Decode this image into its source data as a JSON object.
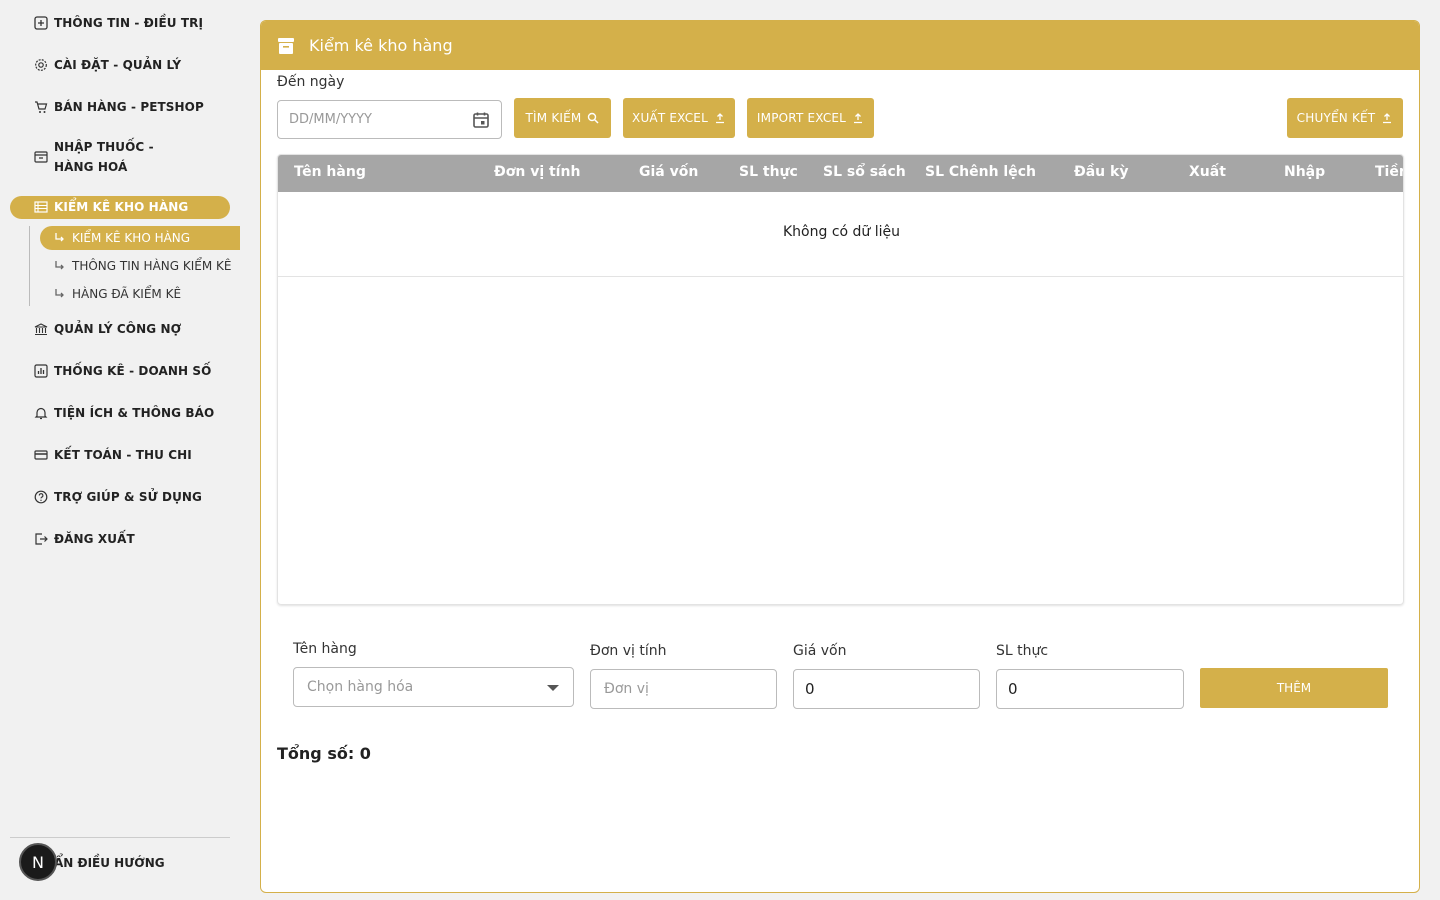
{
  "sidebar": {
    "items": [
      {
        "label": "THÔNG TIN - ĐIỀU TRỊ",
        "icon": "medical-info-icon"
      },
      {
        "label": "CÀI ĐẶT - QUẢN LÝ",
        "icon": "gear-icon"
      },
      {
        "label": "BÁN HÀNG - PETSHOP",
        "icon": "cart-icon"
      },
      {
        "label": "NHẬP THUỐC - HÀNG HOÁ",
        "icon": "archive-icon"
      },
      {
        "label": "KIỂM KÊ KHO HÀNG",
        "icon": "list-icon"
      },
      {
        "label": "QUẢN LÝ CÔNG NỢ",
        "icon": "bank-icon"
      },
      {
        "label": "THỐNG KÊ - DOANH SỐ",
        "icon": "chart-icon"
      },
      {
        "label": "TIỆN ÍCH & THÔNG BÁO",
        "icon": "bell-icon"
      },
      {
        "label": "KẾT TOÁN - THU CHI",
        "icon": "card-icon"
      },
      {
        "label": "TRỢ GIÚP & SỬ DỤNG",
        "icon": "help-icon"
      },
      {
        "label": "ĐĂNG XUẤT",
        "icon": "logout-icon"
      }
    ],
    "sub_items": [
      {
        "label": "KIỂM KÊ KHO HÀNG"
      },
      {
        "label": "THÔNG TIN HÀNG KIỂM KÊ"
      },
      {
        "label": "HÀNG ĐÃ KIỂM KÊ"
      }
    ],
    "collapse_label": "ẨN ĐIỀU HƯỚNG",
    "badge_letter": "N"
  },
  "panel": {
    "title": "Kiểm kê kho hàng",
    "date_label": "Đến ngày",
    "date_placeholder": "DD/MM/YYYY",
    "buttons": {
      "search": "TÌM KIẾM",
      "export_excel": "XUẤT EXCEL",
      "import_excel": "IMPORT EXCEL",
      "transfer": "CHUYỂN KẾT"
    }
  },
  "table": {
    "columns": [
      "Tên hàng",
      "Đơn vị tính",
      "Giá vốn",
      "SL thực",
      "SL sổ sách",
      "SL Chênh lệch",
      "Đầu kỳ",
      "Xuất",
      "Nhập",
      "Tiền"
    ],
    "rows": [],
    "empty_text": "Không có dữ liệu"
  },
  "form": {
    "product_label": "Tên hàng",
    "product_placeholder": "Chọn hàng hóa",
    "unit_label": "Đơn vị tính",
    "unit_placeholder": "Đơn vị",
    "cost_label": "Giá vốn",
    "cost_value": "0",
    "qty_label": "SL thực",
    "qty_value": "0",
    "add_button": "THÊM"
  },
  "total_label": "Tổng số: 0",
  "colors": {
    "accent": "#d4b04a",
    "table_header": "#a6a6a6",
    "background": "#f1f1f1"
  }
}
